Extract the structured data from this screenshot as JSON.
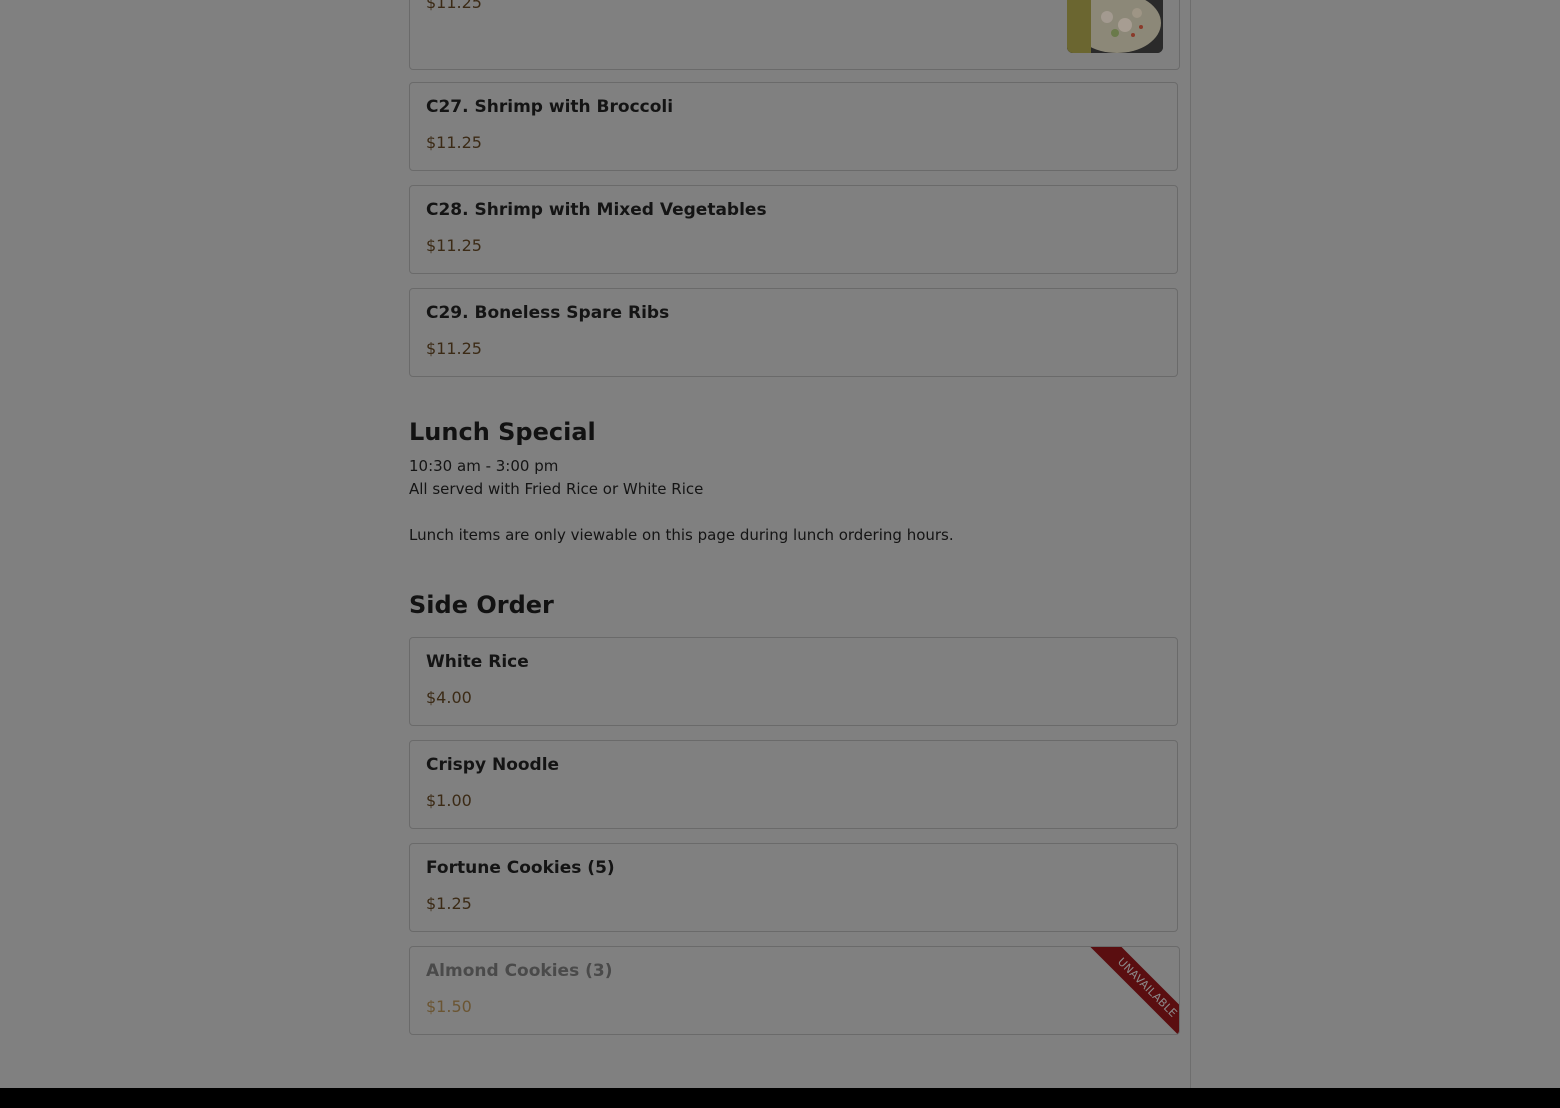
{
  "partial_item": {
    "price": "$11.25",
    "image": "food-photo"
  },
  "items_top": [
    {
      "name": "C27. Shrimp with Broccoli",
      "price": "$11.25"
    },
    {
      "name": "C28. Shrimp with Mixed Vegetables",
      "price": "$11.25"
    },
    {
      "name": "C29. Boneless Spare Ribs",
      "price": "$11.25"
    }
  ],
  "lunch_special": {
    "title": "Lunch Special",
    "hours": "10:30 am - 3:00 pm",
    "description": "All served with Fried Rice or White Rice",
    "note": "Lunch items are only viewable on this page during lunch ordering hours."
  },
  "side_order": {
    "title": "Side Order",
    "items": [
      {
        "name": "White Rice",
        "price": "$4.00"
      },
      {
        "name": "Crispy Noodle",
        "price": "$1.00"
      },
      {
        "name": "Fortune Cookies (5)",
        "price": "$1.25"
      },
      {
        "name": "Almond Cookies (3)",
        "price": "$1.50",
        "badge": "UNAVAILABLE"
      }
    ]
  },
  "colors": {
    "overlay": "#808080",
    "ribbon": "#5a0e10",
    "price": "#3b2a15"
  }
}
